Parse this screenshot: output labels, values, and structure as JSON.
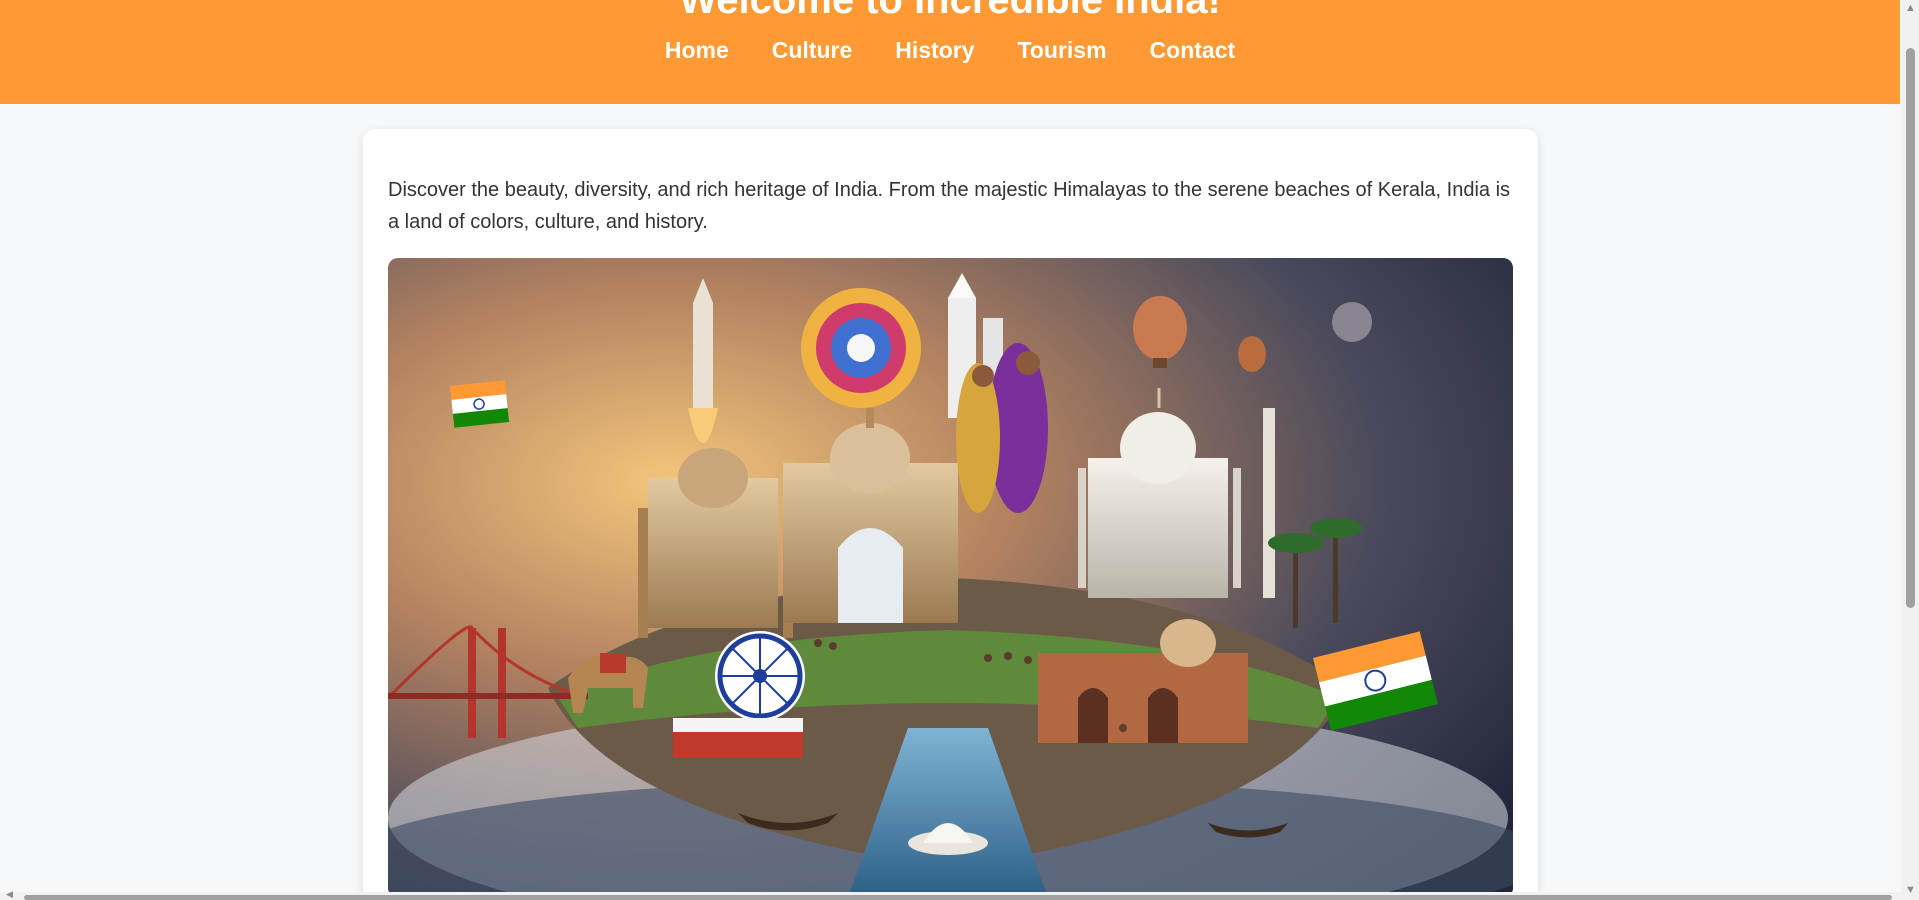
{
  "header": {
    "title": "Welcome to Incredible India!",
    "background_color": "#ff9933"
  },
  "nav": {
    "items": [
      {
        "label": "Home"
      },
      {
        "label": "Culture"
      },
      {
        "label": "History"
      },
      {
        "label": "Tourism"
      },
      {
        "label": "Contact"
      }
    ]
  },
  "main": {
    "intro": "Discover the beauty, diversity, and rich heritage of India. From the majestic Himalayas to the serene beaches of Kerala, India is a land of colors, culture, and history."
  },
  "icons": {
    "scroll_up": "triangle-up",
    "scroll_down": "triangle-down",
    "scroll_left": "triangle-left"
  }
}
